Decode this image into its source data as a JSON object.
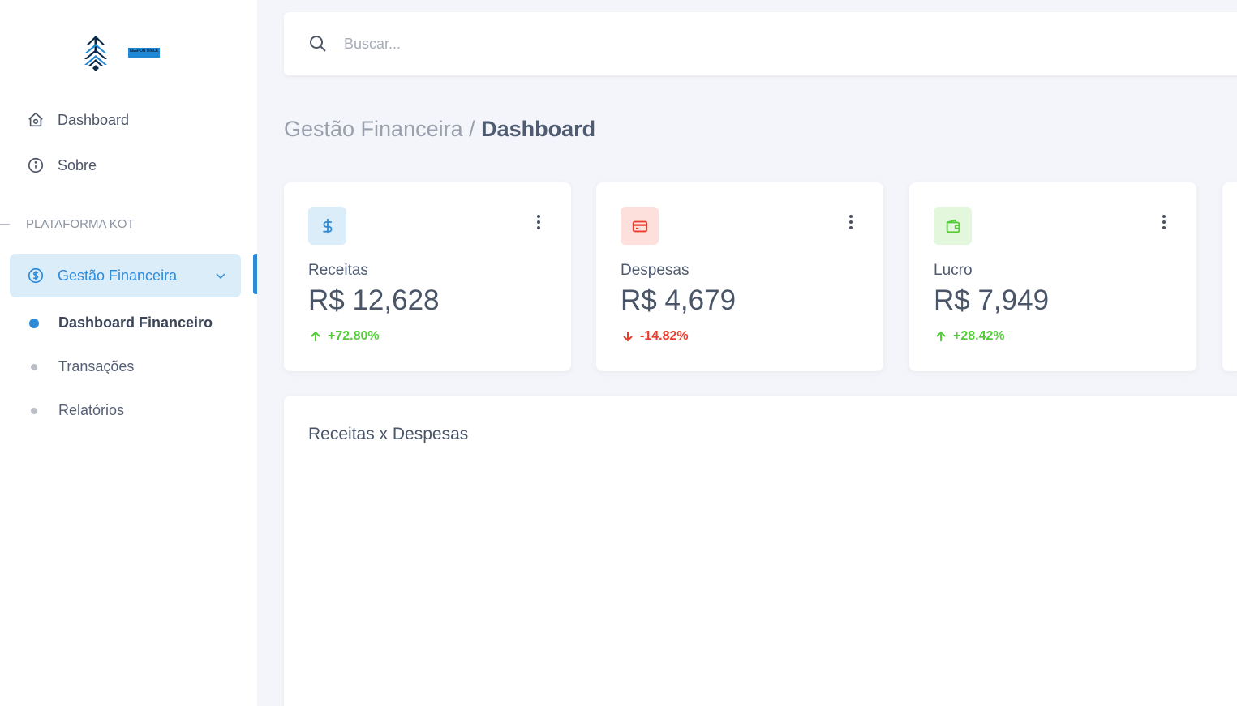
{
  "logo": {
    "text": "KEEP ON TRACK",
    "icon": "tree-arrows-logo"
  },
  "sidebar": {
    "items": [
      {
        "label": "Dashboard",
        "icon": "home-icon"
      },
      {
        "label": "Sobre",
        "icon": "info-icon"
      }
    ],
    "section_label": "PLATAFORMA KOT",
    "group": {
      "label": "Gestão Financeira",
      "icon": "dollar-circle-icon",
      "expanded": true
    },
    "sub_items": [
      {
        "label": "Dashboard Financeiro",
        "active": true
      },
      {
        "label": "Transações",
        "active": false
      },
      {
        "label": "Relatórios",
        "active": false
      }
    ]
  },
  "search": {
    "placeholder": "Buscar...",
    "value": ""
  },
  "breadcrumb": {
    "parent": "Gestão Financeira / ",
    "current": "Dashboard"
  },
  "cards": [
    {
      "label": "Receitas",
      "value": "R$ 12,628",
      "delta": "+72.80%",
      "trend": "up",
      "icon": "dollar-icon",
      "icon_bg": "#dcedfa",
      "icon_color": "#2f8ad6"
    },
    {
      "label": "Despesas",
      "value": "R$ 4,679",
      "delta": "-14.82%",
      "trend": "down",
      "icon": "credit-card-icon",
      "icon_bg": "#fde0dc",
      "icon_color": "#ea3c2b"
    },
    {
      "label": "Lucro",
      "value": "R$ 7,949",
      "delta": "+28.42%",
      "trend": "up",
      "icon": "wallet-icon",
      "icon_bg": "#e2f7dc",
      "icon_color": "#55cc3a"
    }
  ],
  "chart_panel": {
    "title": "Receitas x Despesas"
  },
  "colors": {
    "accent": "#2f8ad6",
    "up": "#55cc3a",
    "down": "#ea3c2b"
  }
}
